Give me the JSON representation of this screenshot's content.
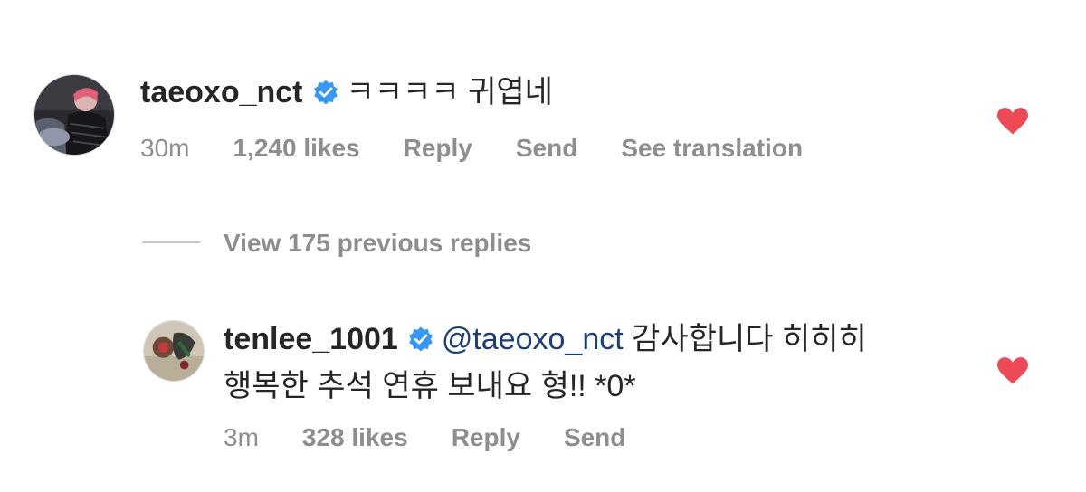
{
  "comment": {
    "username": "taeoxo_nct",
    "verified": true,
    "text": "ㅋㅋㅋㅋ 귀엽네",
    "time": "30m",
    "likes": "1,240 likes",
    "reply": "Reply",
    "send": "Send",
    "translate": "See translation",
    "liked": true
  },
  "view_replies": "View 175 previous replies",
  "reply": {
    "username": "tenlee_1001",
    "verified": true,
    "mention": "@taeoxo_nct",
    "text_line1": "감사합니다 히히히",
    "text_line2": "행복한 추석 연휴 보내요 형!! *0*",
    "time": "3m",
    "likes": "328 likes",
    "reply": "Reply",
    "send": "Send",
    "liked": true
  },
  "colors": {
    "heart": "#ed4956",
    "verified": "#3897f0",
    "mention": "#1b3d7a",
    "meta": "#8e8e8e"
  },
  "icons": {
    "verified": "verified-badge-icon",
    "like": "heart-icon"
  }
}
